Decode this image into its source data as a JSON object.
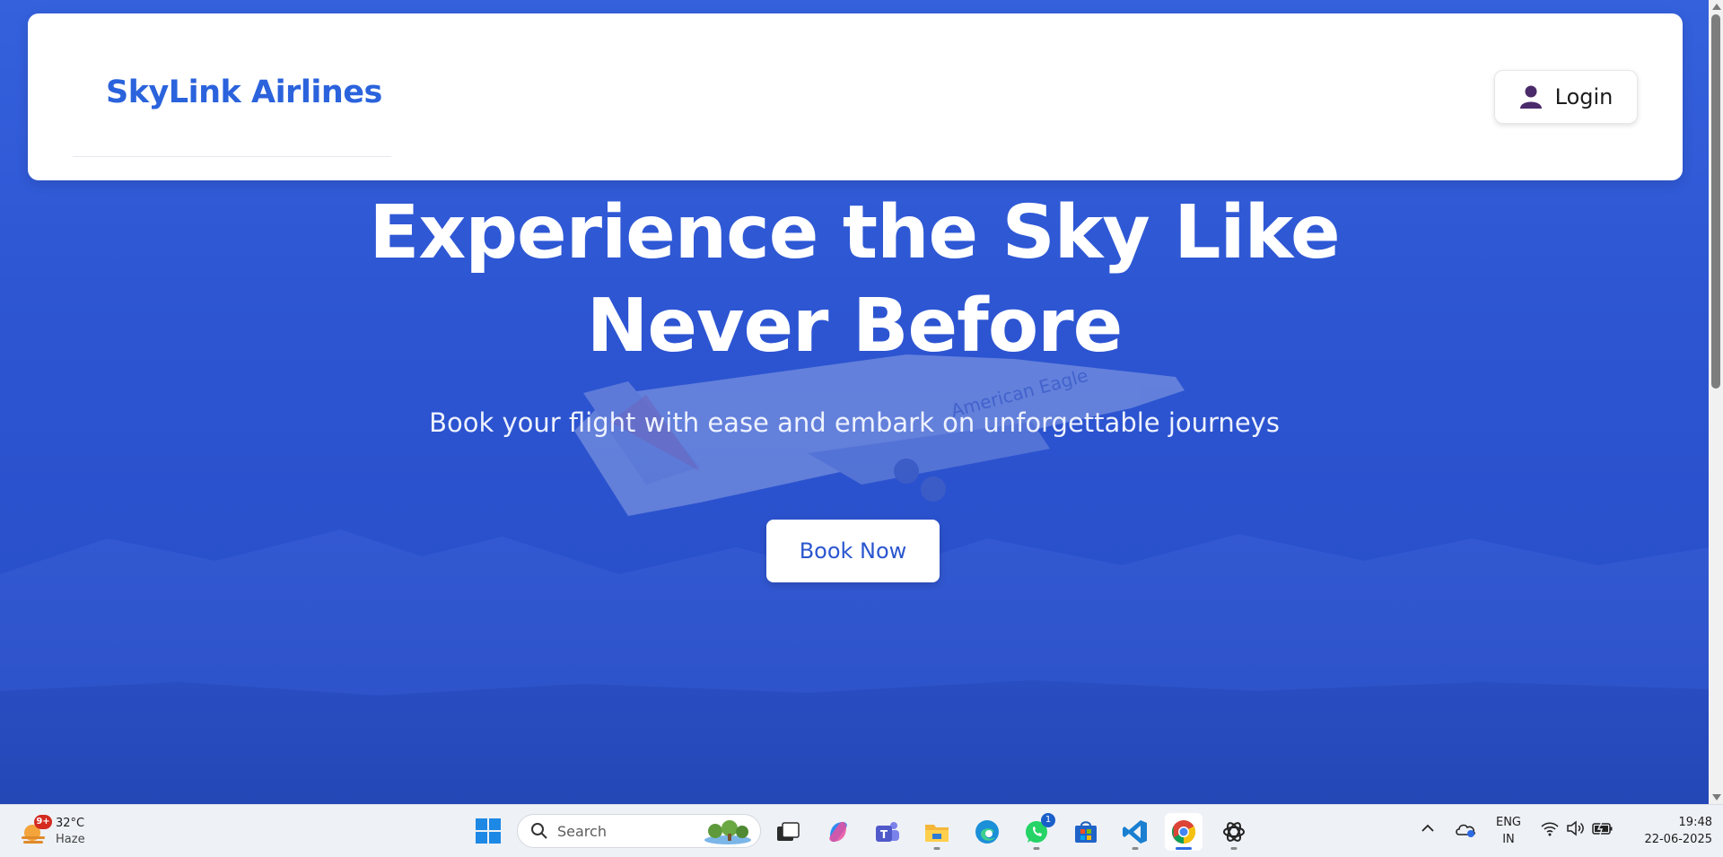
{
  "navbar": {
    "brand": "SkyLink Airlines",
    "login_label": "Login",
    "login_icon": "user-icon"
  },
  "hero": {
    "title_line1": "Experience the Sky Like",
    "title_line2": "Never Before",
    "subtitle": "Book your flight with ease and embark on unforgettable journeys",
    "cta_label": "Book Now",
    "plane_livery_text": "American Eagle"
  },
  "colors": {
    "brand": "#2b63dd",
    "hero_overlay": "#2d55d2",
    "cta_text": "#2a56cf"
  },
  "taskbar": {
    "weather": {
      "badge": "9+",
      "temp": "32°C",
      "condition": "Haze"
    },
    "search_placeholder": "Search",
    "apps": [
      {
        "name": "task-view-icon"
      },
      {
        "name": "copilot-icon"
      },
      {
        "name": "teams-icon"
      },
      {
        "name": "file-explorer-icon"
      },
      {
        "name": "edge-icon"
      },
      {
        "name": "whatsapp-icon",
        "badge": "1"
      },
      {
        "name": "microsoft-store-icon"
      },
      {
        "name": "vscode-icon"
      },
      {
        "name": "chrome-icon"
      },
      {
        "name": "chatgpt-icon"
      }
    ],
    "language": {
      "line1": "ENG",
      "line2": "IN"
    },
    "time": "19:48",
    "date": "22-06-2025"
  }
}
